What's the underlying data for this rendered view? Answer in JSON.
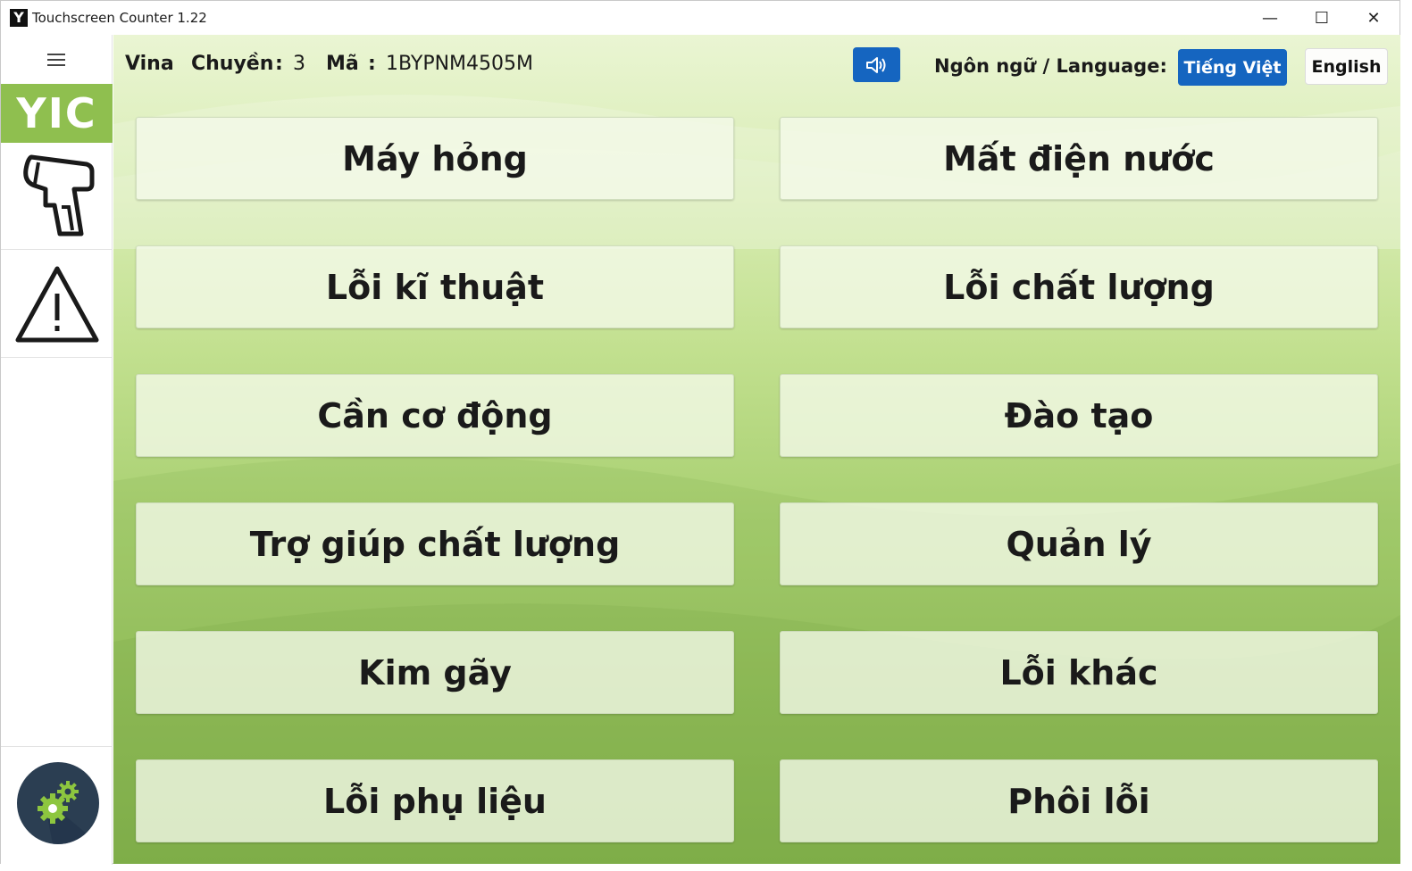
{
  "window": {
    "title": "Touchscreen Counter 1.22",
    "app_icon_letter": "Y",
    "minimize_glyph": "—",
    "maximize_glyph": "☐",
    "close_glyph": "✕"
  },
  "sidebar": {
    "logo_text": "YIC",
    "items": [
      {
        "icon": "barcode-scanner-icon"
      },
      {
        "icon": "warning-icon"
      }
    ],
    "settings_icon": "gears-icon"
  },
  "header": {
    "factory": "Vina",
    "line_label": "Chuyền",
    "line_sep": ":",
    "line_value": "3",
    "code_label": "Mã",
    "code_sep": ":",
    "code_value": "1BYPNM4505M",
    "sound_icon": "speaker-icon",
    "language_label": "Ngôn ngữ / Language:",
    "language_options": [
      "Tiếng Việt",
      "English"
    ],
    "language_selected": "Tiếng Việt"
  },
  "categories": [
    "Máy hỏng",
    "Mất điện nước",
    "Lỗi kĩ thuật",
    "Lỗi chất lượng",
    "Cần cơ động",
    "Đào tạo",
    "Trợ giúp chất lượng",
    "Quản lý",
    "Kim gãy",
    "Lỗi khác",
    "Lỗi phụ liệu",
    "Phôi lỗi"
  ],
  "colors": {
    "accent": "#1565c0",
    "logo_bg": "#8fbf4f",
    "settings_bg": "#2b3e52",
    "gear_green": "#8dc63f"
  }
}
